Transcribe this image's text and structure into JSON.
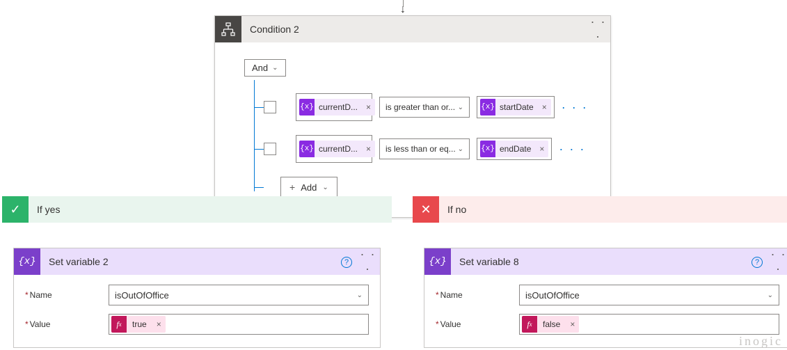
{
  "condition": {
    "title": "Condition 2",
    "group_operator": "And",
    "add_label": "Add",
    "rows": [
      {
        "left_token": "currentD...",
        "operator": "is greater than or...",
        "right_token": "startDate"
      },
      {
        "left_token": "currentD...",
        "operator": "is less than or eq...",
        "right_token": "endDate"
      }
    ]
  },
  "branches": {
    "yes": {
      "title": "If yes",
      "action": {
        "title": "Set variable 2",
        "name_label": "Name",
        "value_label": "Value",
        "name_value": "isOutOfOffice",
        "expr_value": "true"
      }
    },
    "no": {
      "title": "If no",
      "action": {
        "title": "Set variable 8",
        "name_label": "Name",
        "value_label": "Value",
        "name_value": "isOutOfOffice",
        "expr_value": "false"
      }
    }
  },
  "glyphs": {
    "x": "×",
    "help": "?",
    "plus": "+",
    "dots": "· · ·",
    "check": "✓",
    "cross": "✕",
    "chev": "⌄"
  },
  "watermark": "inogic"
}
